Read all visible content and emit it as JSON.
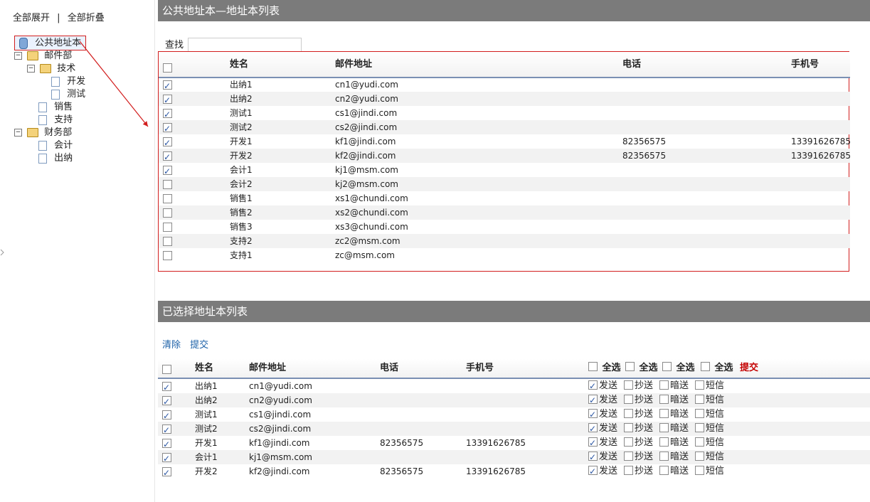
{
  "left": {
    "expand_all": "全部展开",
    "collapse_all": "全部折叠",
    "tree": {
      "root": "公共地址本",
      "mail_dept": "邮件部",
      "tech": "技术",
      "dev": "开发",
      "test": "测试",
      "sales": "销售",
      "support": "支持",
      "finance_dept": "财务部",
      "accounting": "会计",
      "cashier": "出纳"
    }
  },
  "right": {
    "top_header": "公共地址本—地址本列表",
    "search_label": "查找",
    "search_value": "",
    "list_headers": {
      "name": "姓名",
      "email": "邮件地址",
      "phone": "电话",
      "mobile": "手机号"
    },
    "rows": [
      {
        "checked": true,
        "name": "出纳1",
        "email": "cn1@yudi.com",
        "phone": "",
        "mobile": ""
      },
      {
        "checked": true,
        "name": "出纳2",
        "email": "cn2@yudi.com",
        "phone": "",
        "mobile": ""
      },
      {
        "checked": true,
        "name": "测试1",
        "email": "cs1@jindi.com",
        "phone": "",
        "mobile": ""
      },
      {
        "checked": true,
        "name": "测试2",
        "email": "cs2@jindi.com",
        "phone": "",
        "mobile": ""
      },
      {
        "checked": true,
        "name": "开发1",
        "email": "kf1@jindi.com",
        "phone": "82356575",
        "mobile": "13391626785"
      },
      {
        "checked": true,
        "name": "开发2",
        "email": "kf2@jindi.com",
        "phone": "82356575",
        "mobile": "13391626785"
      },
      {
        "checked": true,
        "name": "会计1",
        "email": "kj1@msm.com",
        "phone": "",
        "mobile": ""
      },
      {
        "checked": false,
        "name": "会计2",
        "email": "kj2@msm.com",
        "phone": "",
        "mobile": ""
      },
      {
        "checked": false,
        "name": "销售1",
        "email": "xs1@chundi.com",
        "phone": "",
        "mobile": ""
      },
      {
        "checked": false,
        "name": "销售2",
        "email": "xs2@chundi.com",
        "phone": "",
        "mobile": ""
      },
      {
        "checked": false,
        "name": "销售3",
        "email": "xs3@chundi.com",
        "phone": "",
        "mobile": ""
      },
      {
        "checked": false,
        "name": "支持2",
        "email": "zc2@msm.com",
        "phone": "",
        "mobile": ""
      },
      {
        "checked": false,
        "name": "支持1",
        "email": "zc@msm.com",
        "phone": "",
        "mobile": ""
      }
    ],
    "selected_header": "已选择地址本列表",
    "actions": {
      "clear": "清除",
      "submit": "提交"
    },
    "selected_headers": {
      "name": "姓名",
      "email": "邮件地址",
      "phone": "电话",
      "mobile": "手机号",
      "select_all": "全选",
      "submit": "提交"
    },
    "option_labels": {
      "send": "发送",
      "cc": "抄送",
      "bcc": "暗送",
      "sms": "短信"
    },
    "selected_rows": [
      {
        "checked": true,
        "name": "出纳1",
        "email": "cn1@yudi.com",
        "phone": "",
        "mobile": "",
        "send": true,
        "cc": false,
        "bcc": false,
        "sms": false
      },
      {
        "checked": true,
        "name": "出纳2",
        "email": "cn2@yudi.com",
        "phone": "",
        "mobile": "",
        "send": true,
        "cc": false,
        "bcc": false,
        "sms": false
      },
      {
        "checked": true,
        "name": "测试1",
        "email": "cs1@jindi.com",
        "phone": "",
        "mobile": "",
        "send": true,
        "cc": false,
        "bcc": false,
        "sms": false
      },
      {
        "checked": true,
        "name": "测试2",
        "email": "cs2@jindi.com",
        "phone": "",
        "mobile": "",
        "send": true,
        "cc": false,
        "bcc": false,
        "sms": false
      },
      {
        "checked": true,
        "name": "开发1",
        "email": "kf1@jindi.com",
        "phone": "82356575",
        "mobile": "13391626785",
        "send": true,
        "cc": false,
        "bcc": false,
        "sms": false
      },
      {
        "checked": true,
        "name": "会计1",
        "email": "kj1@msm.com",
        "phone": "",
        "mobile": "",
        "send": true,
        "cc": false,
        "bcc": false,
        "sms": false
      },
      {
        "checked": true,
        "name": "开发2",
        "email": "kf2@jindi.com",
        "phone": "82356575",
        "mobile": "13391626785",
        "send": true,
        "cc": false,
        "bcc": false,
        "sms": false
      }
    ]
  }
}
